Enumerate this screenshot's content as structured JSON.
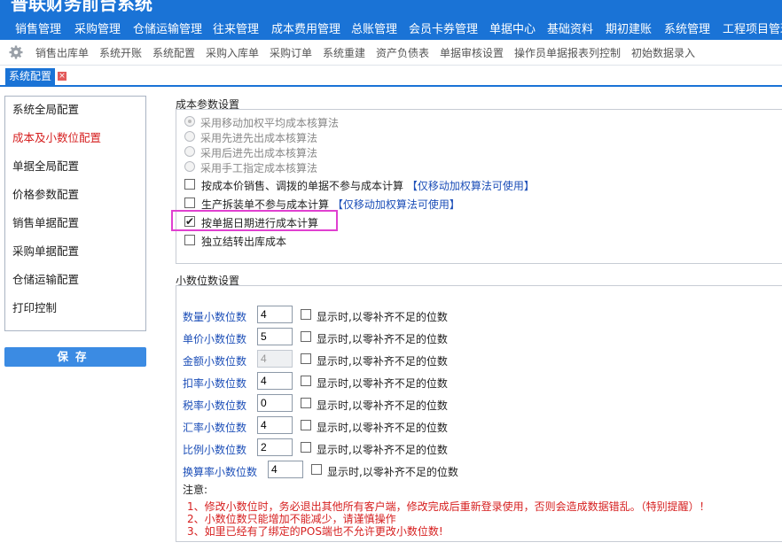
{
  "app": {
    "title": "普联财务前台系统"
  },
  "menu": [
    "销售管理",
    "采购管理",
    "仓储运输管理",
    "往来管理",
    "成本费用管理",
    "总账管理",
    "会员卡券管理",
    "单据中心",
    "基础资料",
    "期初建账",
    "系统管理",
    "工程项目管理"
  ],
  "quick": [
    "销售出库单",
    "系统开账",
    "系统配置",
    "采购入库单",
    "采购订单",
    "系统重建",
    "资产负债表",
    "单据审核设置",
    "操作员单据报表列控制",
    "初始数据录入"
  ],
  "tab": {
    "label": "系统配置",
    "close": "×"
  },
  "sidebar": {
    "items": [
      "系统全局配置",
      "成本及小数位配置",
      "单据全局配置",
      "价格参数配置",
      "销售单据配置",
      "采购单据配置",
      "仓储运输配置",
      "打印控制"
    ],
    "active": "成本及小数位配置"
  },
  "save_label": "保存",
  "cost": {
    "title": "成本参数设置",
    "methods": [
      {
        "label": "采用移动加权平均成本核算法",
        "selected": true
      },
      {
        "label": "采用先进先出成本核算法",
        "selected": false
      },
      {
        "label": "采用后进先出成本核算法",
        "selected": false
      },
      {
        "label": "采用手工指定成本核算法",
        "selected": false
      }
    ],
    "options": [
      {
        "label": "按成本价销售、调拨的单据不参与成本计算",
        "hint": "【仅移动加权算法可使用】",
        "checked": false
      },
      {
        "label": "生产拆装单不参与成本计算",
        "hint": "【仅移动加权算法可使用】",
        "checked": false
      },
      {
        "label": "按单据日期进行成本计算",
        "hint": "",
        "checked": true
      },
      {
        "label": "独立结转出库成本",
        "hint": "",
        "checked": false
      }
    ],
    "check_mark": "✔"
  },
  "decimal": {
    "title": "小数位数设置",
    "rows": [
      {
        "label": "数量小数位数",
        "value": "4",
        "disabled": false,
        "pad_label": "显示时,以零补齐不足的位数"
      },
      {
        "label": "单价小数位数",
        "value": "5",
        "disabled": false,
        "pad_label": "显示时,以零补齐不足的位数"
      },
      {
        "label": "金额小数位数",
        "value": "4",
        "disabled": true,
        "pad_label": "显示时,以零补齐不足的位数"
      },
      {
        "label": "扣率小数位数",
        "value": "4",
        "disabled": false,
        "pad_label": "显示时,以零补齐不足的位数"
      },
      {
        "label": "税率小数位数",
        "value": "0",
        "disabled": false,
        "pad_label": "显示时,以零补齐不足的位数"
      },
      {
        "label": "汇率小数位数",
        "value": "4",
        "disabled": false,
        "pad_label": "显示时,以零补齐不足的位数"
      },
      {
        "label": "比例小数位数",
        "value": "2",
        "disabled": false,
        "pad_label": "显示时,以零补齐不足的位数"
      },
      {
        "label": "换算率小数位数",
        "value": "4",
        "disabled": false,
        "pad_label": "显示时,以零补齐不足的位数"
      }
    ],
    "note_title": "注意:",
    "notes": [
      "1、修改小数位时，务必退出其他所有客户端，修改完成后重新登录使用，否则会造成数据错乱。（特别提醒）！",
      "2、小数位数只能增加不能减少，请谨慎操作",
      "3、如里已经有了绑定的POS端也不允许更改小数位数!"
    ]
  }
}
